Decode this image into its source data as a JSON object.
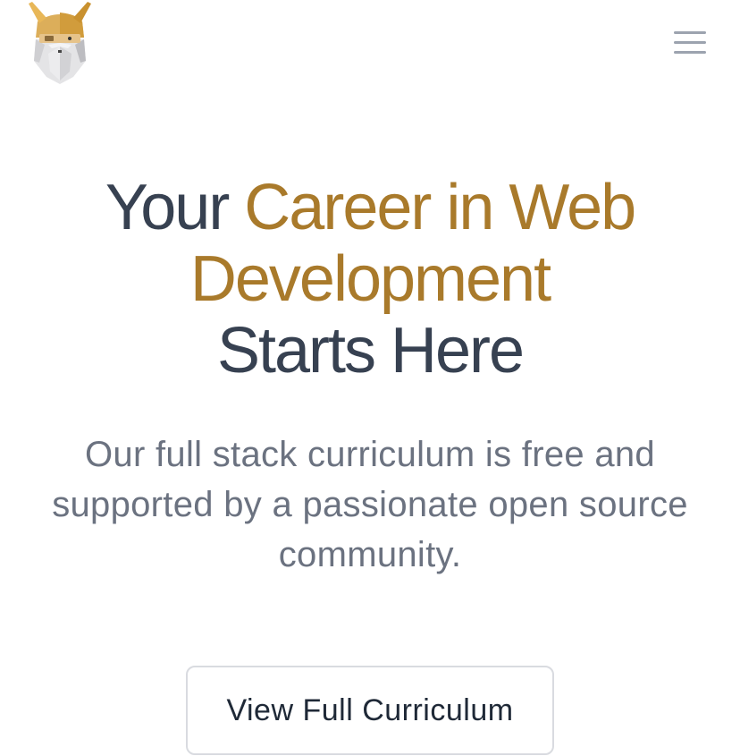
{
  "header": {
    "logo": "viking-head-logo-icon",
    "menu_icon": "hamburger-menu-icon"
  },
  "hero": {
    "headline_part1": "Your ",
    "headline_accent1": "Career in Web",
    "headline_accent2": "Development",
    "headline_part2": "Starts Here",
    "subtitle": "Our full stack curriculum is free and supported by a passionate open source community.",
    "cta_label": "View Full Curriculum"
  },
  "colors": {
    "accent": "#a97a2b",
    "heading": "#374151",
    "body_text": "#6b7280",
    "button_border": "#d9dbe0"
  }
}
